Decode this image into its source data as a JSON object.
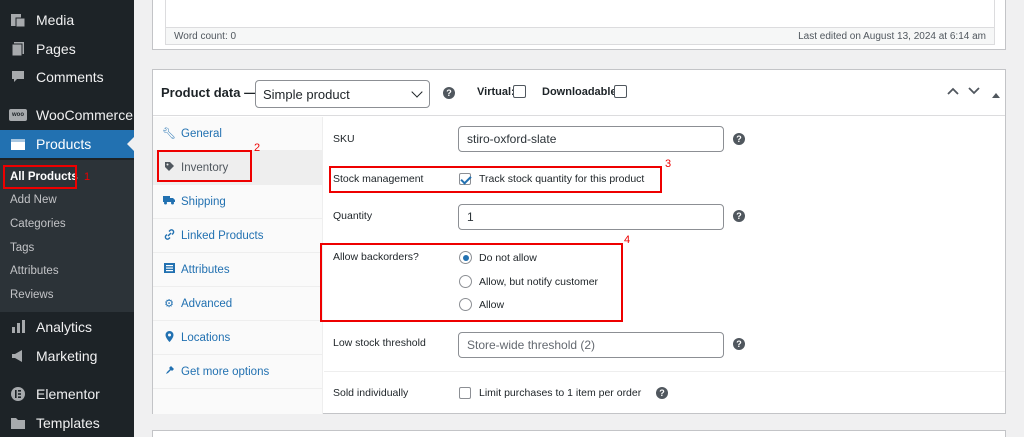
{
  "sidebar": {
    "items": [
      {
        "label": "Media",
        "icon": "media-icon"
      },
      {
        "label": "Pages",
        "icon": "pages-icon"
      },
      {
        "label": "Comments",
        "icon": "comments-icon"
      },
      {
        "label": "WooCommerce",
        "icon": "woocommerce-icon"
      },
      {
        "label": "Products",
        "icon": "products-icon"
      },
      {
        "label": "Analytics",
        "icon": "analytics-icon"
      },
      {
        "label": "Marketing",
        "icon": "marketing-icon"
      },
      {
        "label": "Elementor",
        "icon": "elementor-icon"
      },
      {
        "label": "Templates",
        "icon": "templates-icon"
      }
    ],
    "woo_badge": "woo",
    "products_submenu": [
      "All Products",
      "Add New",
      "Categories",
      "Tags",
      "Attributes",
      "Reviews"
    ]
  },
  "editor": {
    "word_count": "Word count: 0",
    "last_edited": "Last edited on August 13, 2024 at 6:14 am"
  },
  "product_data": {
    "title": "Product data —",
    "type_value": "Simple product",
    "virtual_label": "Virtual:",
    "downloadable_label": "Downloadable:",
    "help": "?",
    "tabs": [
      {
        "label": "General",
        "icon": "wrench-icon"
      },
      {
        "label": "Inventory",
        "icon": "tag-icon"
      },
      {
        "label": "Shipping",
        "icon": "truck-icon"
      },
      {
        "label": "Linked Products",
        "icon": "link-icon"
      },
      {
        "label": "Attributes",
        "icon": "list-icon"
      },
      {
        "label": "Advanced",
        "icon": "gear-icon"
      },
      {
        "label": "Locations",
        "icon": "location-pin-icon"
      },
      {
        "label": "Get more options",
        "icon": "plugin-icon"
      }
    ],
    "fields": {
      "sku_label": "SKU",
      "sku_value": "stiro-oxford-slate",
      "stock_mgmt_label": "Stock management",
      "stock_mgmt_text": "Track stock quantity for this product",
      "stock_mgmt_checked": true,
      "quantity_label": "Quantity",
      "quantity_value": "1",
      "backorders_label": "Allow backorders?",
      "backorders_options": [
        "Do not allow",
        "Allow, but notify customer",
        "Allow"
      ],
      "backorders_selected": "Do not allow",
      "low_stock_label": "Low stock threshold",
      "low_stock_placeholder": "Store-wide threshold (2)",
      "sold_individually_label": "Sold individually",
      "sold_individually_text": "Limit purchases to 1 item per order"
    }
  },
  "annotations": {
    "color": "#ee0000",
    "numbers": [
      "1",
      "2",
      "3",
      "4"
    ]
  }
}
